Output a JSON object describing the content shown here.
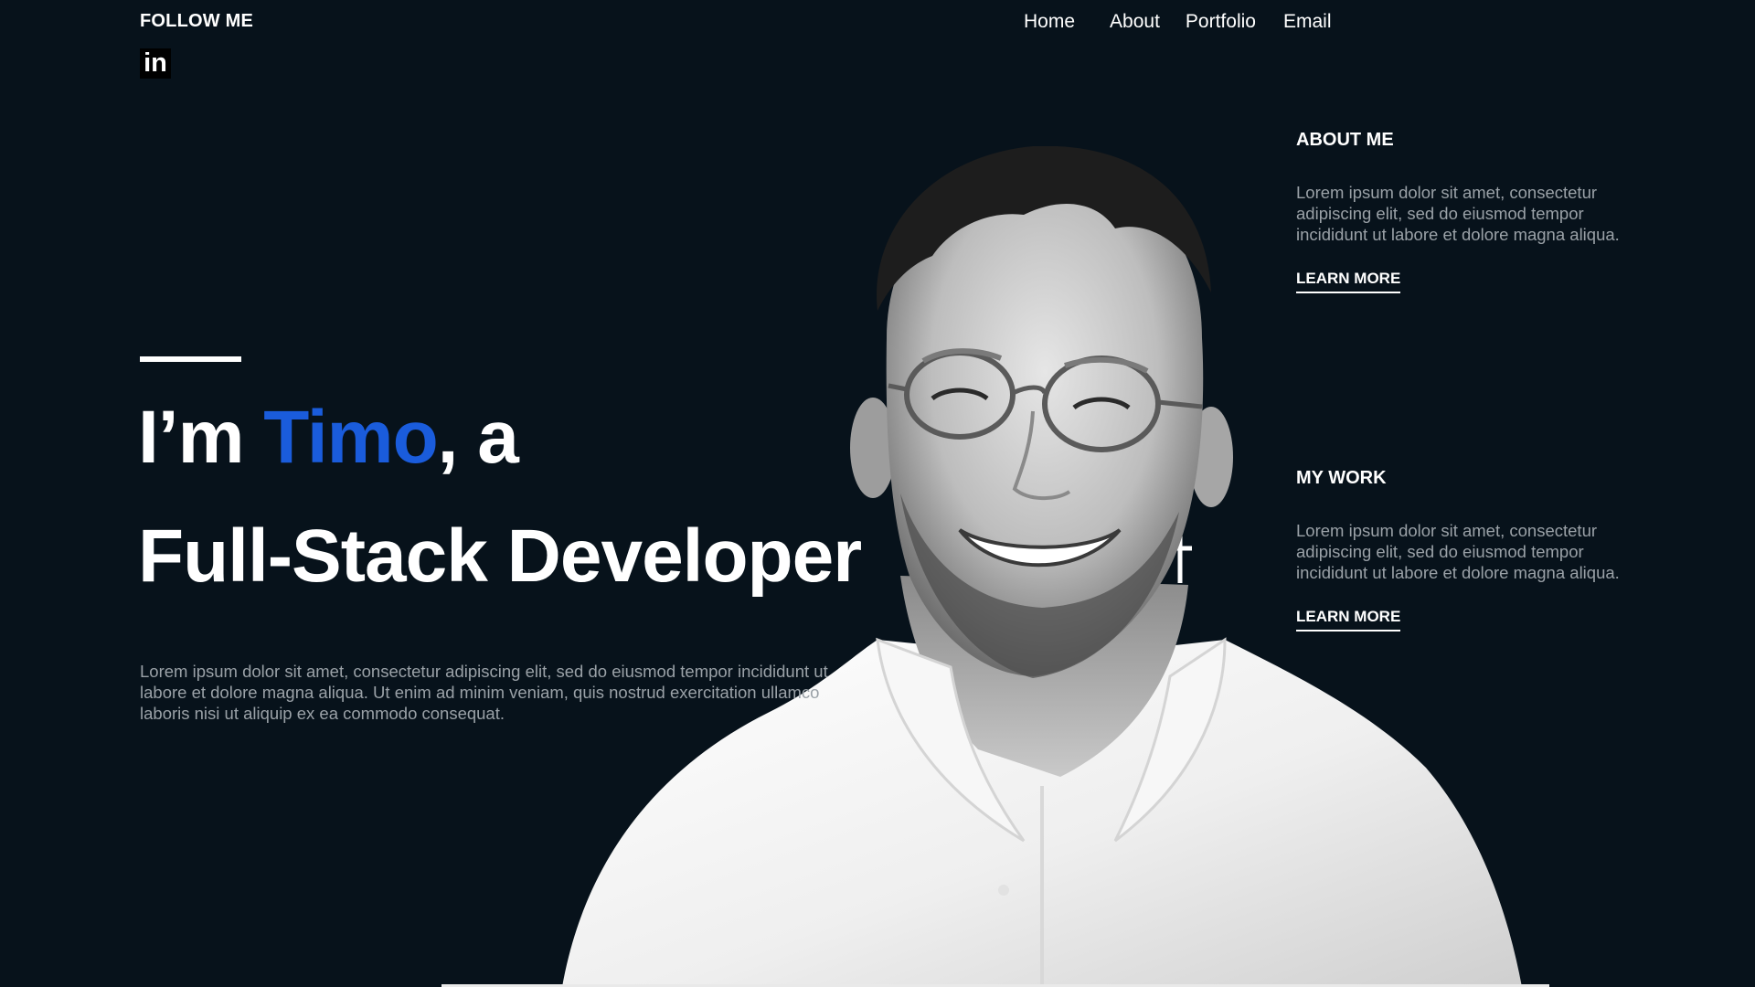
{
  "header": {
    "follow_label": "FOLLOW ME",
    "social_icon_label": "in",
    "nav": {
      "home": "Home",
      "about": "About",
      "portfolio": "Portfolio",
      "email": "Email"
    }
  },
  "hero": {
    "prefix": "I’m ",
    "name": "Timo",
    "suffix": ", a",
    "role": "Full-Stack Developer",
    "description": "Lorem ipsum dolor sit amet, consectetur adipiscing elit, sed do eiusmod tempor incididunt ut labore et dolore magna aliqua. Ut enim ad minim veniam, quis nostrud exercitation ullamco laboris nisi ut aliquip ex ea commodo consequat."
  },
  "about": {
    "title": "ABOUT ME",
    "text": "Lorem ipsum dolor sit amet, consectetur adipiscing elit, sed do eiusmod tempor incididunt ut labore et dolore magna aliqua.",
    "link": "LEARN MORE"
  },
  "work": {
    "title": "MY WORK",
    "text": "Lorem ipsum dolor sit amet, consectetur adipiscing elit, sed do eiusmod tempor incididunt ut labore et dolore magna aliqua.",
    "link": "LEARN MORE"
  },
  "colors": {
    "background": "#07121b",
    "accent": "#1a5cdc",
    "text": "#ffffff",
    "muted": "#9aa1a7"
  }
}
